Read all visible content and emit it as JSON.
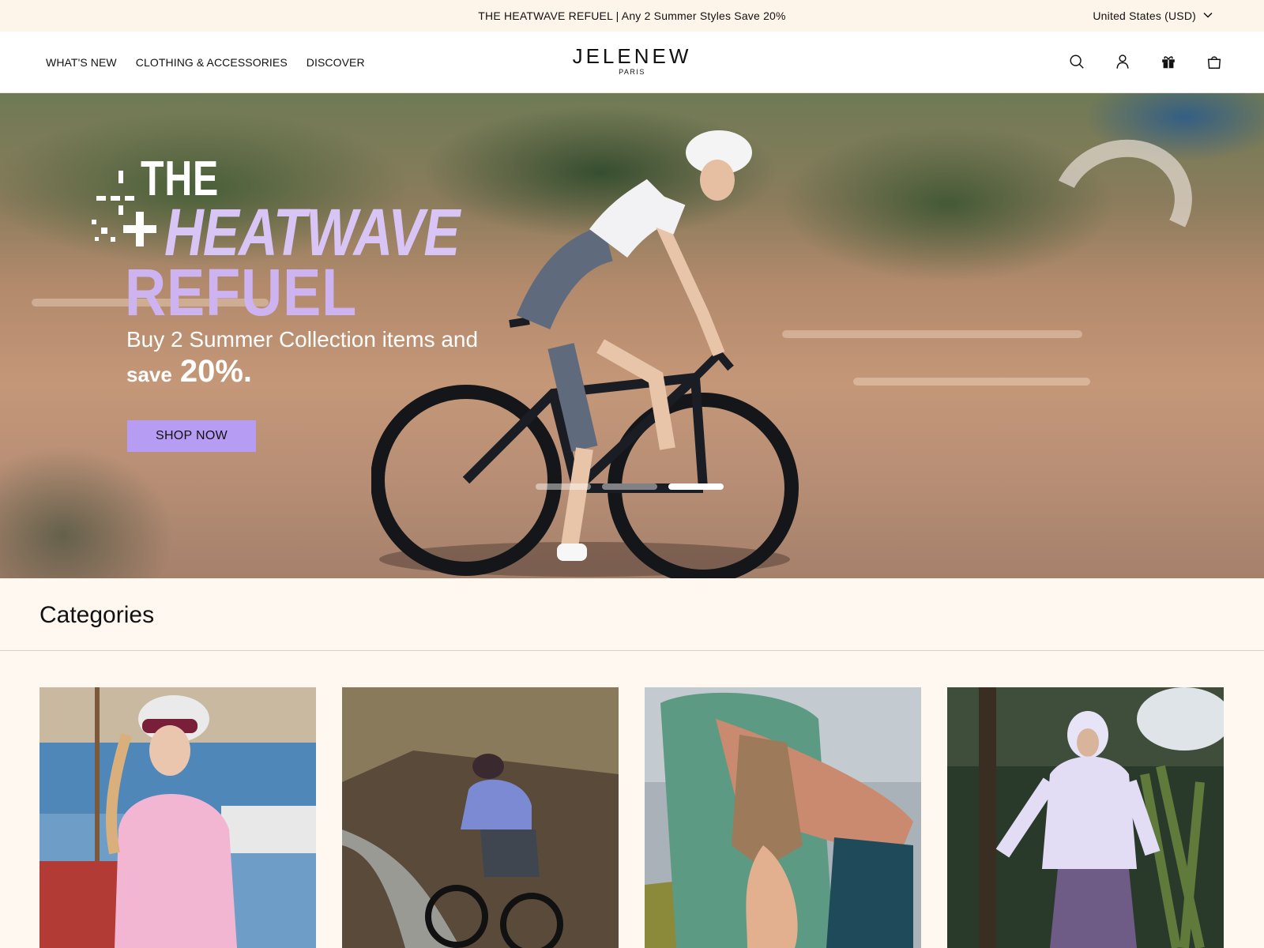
{
  "announcement": {
    "text": "THE HEATWAVE REFUEL | Any 2 Summer Styles Save 20%"
  },
  "locale": {
    "label": "United States (USD)"
  },
  "nav": {
    "items": [
      {
        "label": "WHAT'S NEW"
      },
      {
        "label": "CLOTHING & ACCESSORIES"
      },
      {
        "label": "DISCOVER"
      }
    ]
  },
  "logo": {
    "brand": "JELENEW",
    "sub": "PARIS"
  },
  "header_icons": [
    "search-icon",
    "account-icon",
    "gift-icon",
    "cart-icon"
  ],
  "hero": {
    "title_line1": "THE",
    "title_line2": "HEATWAVE",
    "title_line3": "REFUEL",
    "subtitle": "Buy 2 Summer Collection items and",
    "save_word": "save",
    "save_percent": "20%.",
    "button_label": "SHOP NOW",
    "slides": {
      "count": 3,
      "active": 3
    }
  },
  "categories": {
    "heading": "Categories",
    "cards": [
      {
        "image": "cyclist-pink-jersey-harbor"
      },
      {
        "image": "cyclist-blue-jersey-road"
      },
      {
        "image": "cyclist-green-vest-closeup"
      },
      {
        "image": "woman-lavender-hoodie-forest"
      }
    ]
  },
  "colors": {
    "announce_bg": "#fdf5ea",
    "page_bg": "#fff8f0",
    "accent_lavender": "#b79cf4",
    "title_lavender": "#d8c4f5"
  }
}
